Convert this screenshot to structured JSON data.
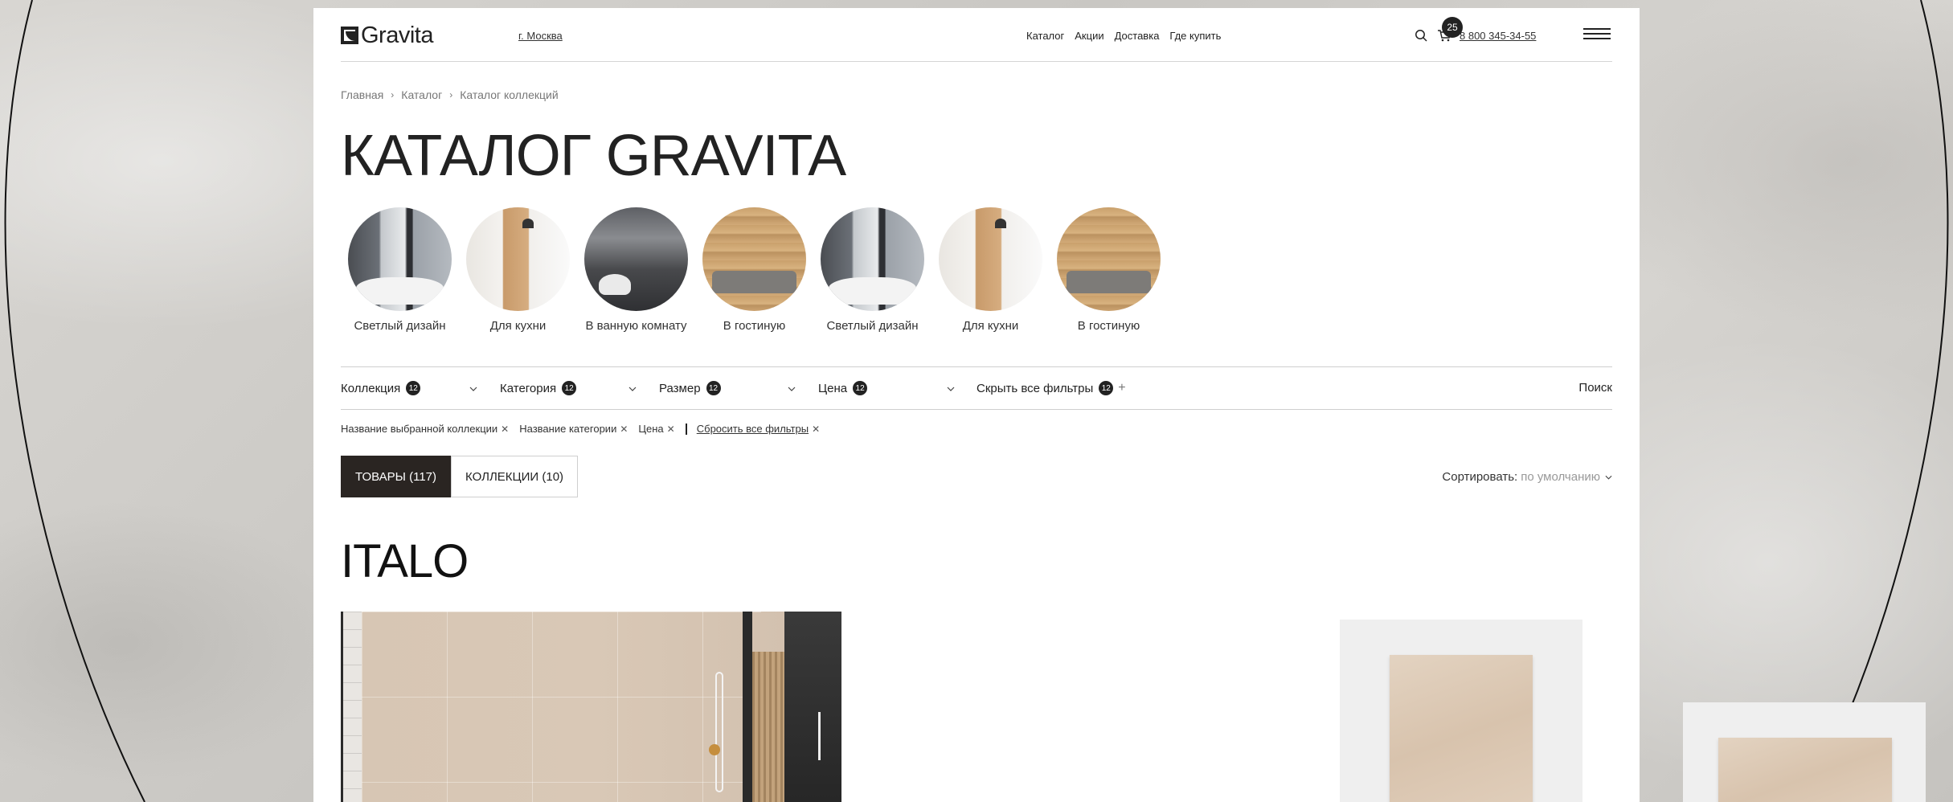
{
  "header": {
    "logo_text": "Gravita",
    "city": "г. Москва",
    "nav": [
      "Каталог",
      "Акции",
      "Доставка",
      "Где купить"
    ],
    "cart_count": "25",
    "phone": "8 800 345-34-55"
  },
  "breadcrumb": [
    "Главная",
    "Каталог",
    "Каталог коллекций"
  ],
  "title": "КАТАЛОГ GRAVITA",
  "categories": [
    {
      "label": "Светлый дизайн"
    },
    {
      "label": "Для кухни"
    },
    {
      "label": "В ванную комнату"
    },
    {
      "label": "В гостиную"
    },
    {
      "label": "Светлый дизайн"
    },
    {
      "label": "Для кухни"
    },
    {
      "label": "В гостиную"
    }
  ],
  "filters": {
    "items": [
      {
        "label": "Коллекция",
        "count": "12"
      },
      {
        "label": "Категория",
        "count": "12"
      },
      {
        "label": "Размер",
        "count": "12"
      },
      {
        "label": "Цена",
        "count": "12"
      }
    ],
    "hide_all": {
      "label": "Скрыть все фильтры",
      "count": "12"
    },
    "search": "Поиск"
  },
  "chips": {
    "items": [
      "Название выбранной коллекции",
      "Название категории",
      "Цена"
    ],
    "reset": "Сбросить все фильтры"
  },
  "tabs": [
    {
      "label": "ТОВАРЫ (117)",
      "active": true
    },
    {
      "label": "КОЛЛЕКЦИИ (10)",
      "active": false
    }
  ],
  "sort": {
    "label": "Сортировать:",
    "value": "по умолчанию"
  },
  "collection_title": "ITALO",
  "colors": {
    "accent": "#2a2522",
    "background": "#ffffff"
  }
}
